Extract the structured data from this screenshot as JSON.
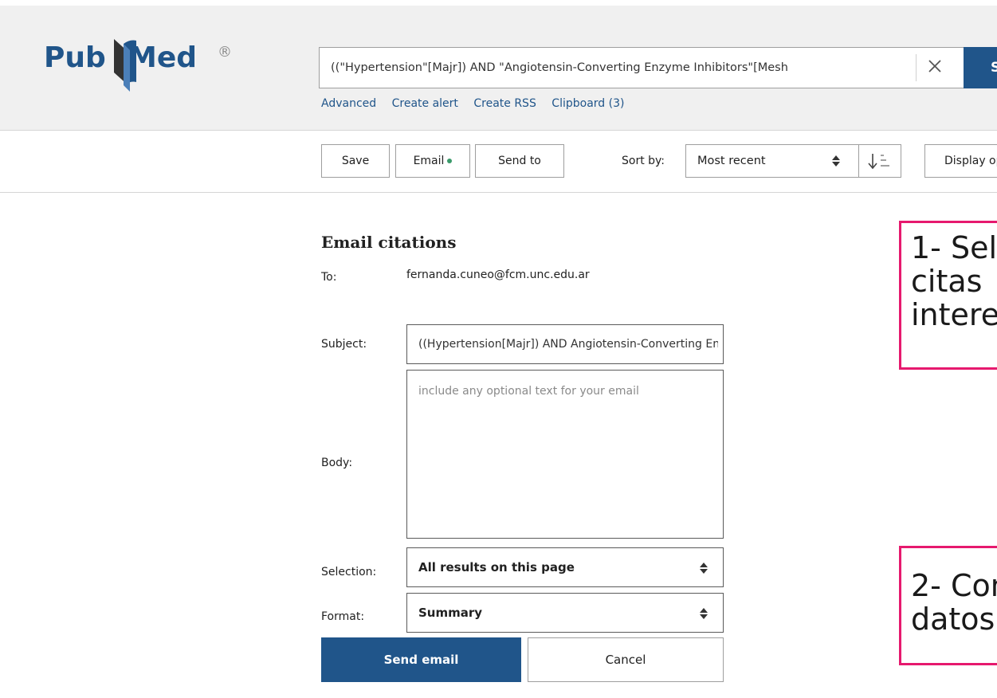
{
  "logo": {
    "pub": "Pub",
    "med": "Med",
    "reg": "®"
  },
  "search": {
    "query": "((\"Hypertension\"[Majr]) AND \"Angiotensin-Converting Enzyme Inhibitors\"[Mesh",
    "button_label": "Search",
    "links": [
      "Advanced",
      "Create alert",
      "Create RSS",
      "Clipboard (3)"
    ]
  },
  "toolbar": {
    "save": "Save",
    "email": "Email",
    "send_to": "Send to",
    "sort_by_label": "Sort by:",
    "sort_value": "Most recent",
    "display_options": "Display options"
  },
  "email_form": {
    "title": "Email citations",
    "to_label": "To:",
    "to_value": "fernanda.cuneo@fcm.unc.edu.ar",
    "subject_label": "Subject:",
    "subject_value": "((Hypertension[Majr]) AND Angiotensin-Converting Enzyme Inhibitors[Mesh])",
    "body_label": "Body:",
    "body_placeholder": "include any optional text for your email",
    "selection_label": "Selection:",
    "selection_value": "All results on this page",
    "format_label": "Format:",
    "format_value": "Summary",
    "send_label": "Send email",
    "cancel_label": "Cancel"
  },
  "annotations": {
    "note1_lines": [
      "1- Sel",
      "citas",
      "intere"
    ],
    "note2_lines": [
      "2- Con",
      "datos"
    ],
    "border_color": "#e6196e"
  },
  "colors": {
    "brand_blue": "#20558a",
    "email_dot": "#3a9a6a"
  }
}
